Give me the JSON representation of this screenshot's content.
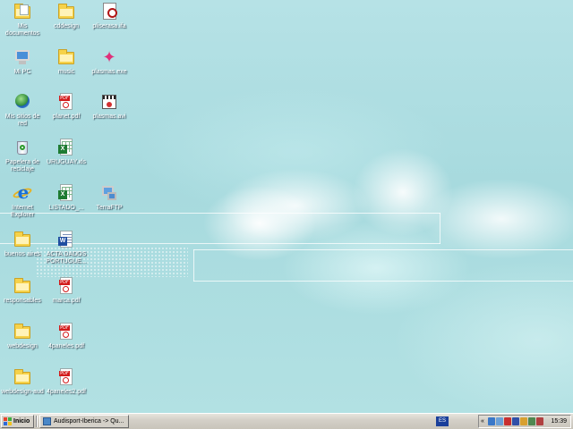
{
  "desktop": {
    "icons": [
      {
        "label": "Mis documentos",
        "icon": "my-documents-icon"
      },
      {
        "label": "Mi PC",
        "icon": "my-computer-icon"
      },
      {
        "label": "Mis sitios de red",
        "icon": "network-places-icon"
      },
      {
        "label": "Papelera de reciclaje",
        "icon": "recycle-bin-icon"
      },
      {
        "label": "Internet Explorer",
        "icon": "internet-explorer-icon"
      },
      {
        "label": "buenos aires",
        "icon": "folder-icon"
      },
      {
        "label": "responsables",
        "icon": "folder-icon"
      },
      {
        "label": "webdesign",
        "icon": "folder-icon"
      },
      {
        "label": "webdesign-aud",
        "icon": "folder-icon"
      },
      {
        "label": "cddesign",
        "icon": "folder-icon"
      },
      {
        "label": "music",
        "icon": "folder-icon"
      },
      {
        "label": "planet.pdf",
        "icon": "pdf-file-icon"
      },
      {
        "label": "URUGUAY.xls",
        "icon": "excel-file-icon"
      },
      {
        "label": "LISTADO_...",
        "icon": "excel-file-icon"
      },
      {
        "label": "ACTA DADOS PORTUGUE...",
        "icon": "word-file-icon"
      },
      {
        "label": "marca.pdf",
        "icon": "pdf-file-icon"
      },
      {
        "label": "4paneles.pdf",
        "icon": "pdf-file-icon"
      },
      {
        "label": "4paneles2.pdf",
        "icon": "pdf-file-icon"
      },
      {
        "label": "pliserasa.ifa",
        "icon": "media-file-icon"
      },
      {
        "label": "plasmas.exe",
        "icon": "plasma-app-icon"
      },
      {
        "label": "plasmas.avi",
        "icon": "video-file-icon"
      },
      {
        "label": "TerraFTP",
        "icon": "ftp-app-icon"
      }
    ]
  },
  "taskbar": {
    "start_label": "Inicio",
    "task_label": "Audisport-Iberica -> Qu...",
    "language": "ES",
    "tray_chevron": "«",
    "clock": "15:39"
  },
  "colors": {
    "desktop": "#a9dde0",
    "taskbar": "#d4d0c8",
    "folder": "#f6d24a",
    "pdf": "#d21b1b",
    "excel": "#1e7b32",
    "word": "#1f4da0"
  }
}
